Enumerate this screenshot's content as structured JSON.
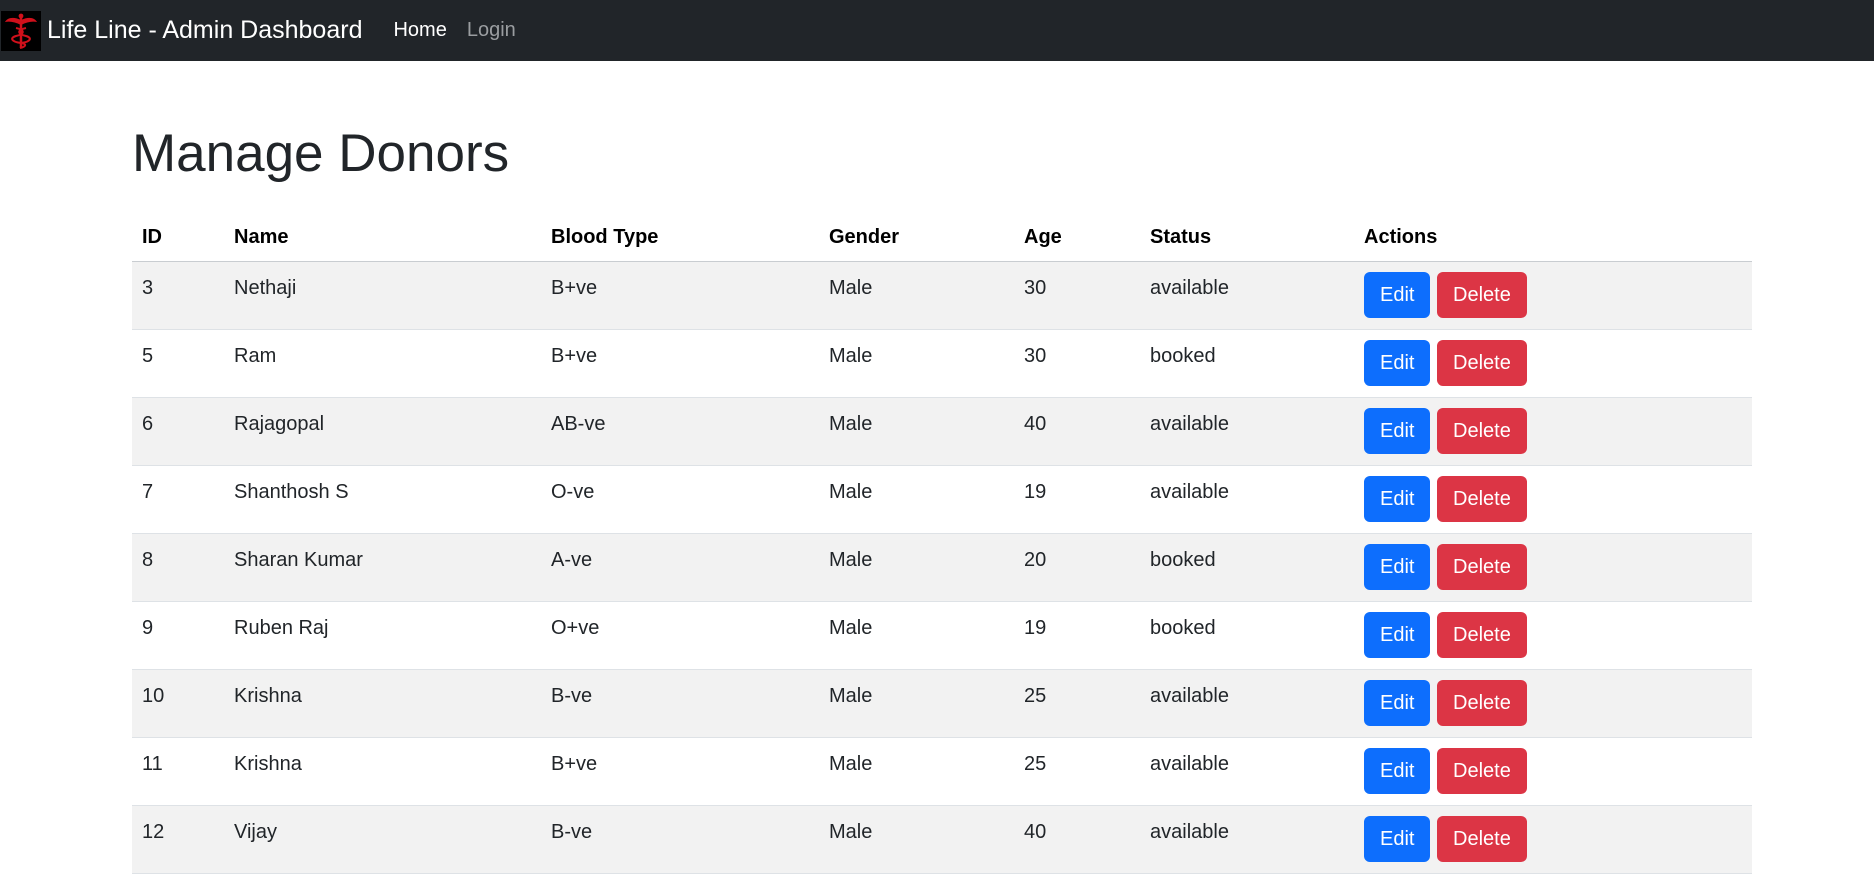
{
  "navbar": {
    "brand": "Life Line - Admin Dashboard",
    "links": [
      {
        "label": "Home",
        "active": true
      },
      {
        "label": "Login",
        "active": false
      }
    ]
  },
  "page": {
    "title": "Manage Donors"
  },
  "table": {
    "headers": [
      "ID",
      "Name",
      "Blood Type",
      "Gender",
      "Age",
      "Status",
      "Actions"
    ],
    "rows": [
      {
        "id": "3",
        "name": "Nethaji",
        "blood_type": "B+ve",
        "gender": "Male",
        "age": "30",
        "status": "available"
      },
      {
        "id": "5",
        "name": "Ram",
        "blood_type": "B+ve",
        "gender": "Male",
        "age": "30",
        "status": "booked"
      },
      {
        "id": "6",
        "name": "Rajagopal",
        "blood_type": "AB-ve",
        "gender": "Male",
        "age": "40",
        "status": "available"
      },
      {
        "id": "7",
        "name": "Shanthosh S",
        "blood_type": "O-ve",
        "gender": "Male",
        "age": "19",
        "status": "available"
      },
      {
        "id": "8",
        "name": "Sharan Kumar",
        "blood_type": "A-ve",
        "gender": "Male",
        "age": "20",
        "status": "booked"
      },
      {
        "id": "9",
        "name": "Ruben Raj",
        "blood_type": "O+ve",
        "gender": "Male",
        "age": "19",
        "status": "booked"
      },
      {
        "id": "10",
        "name": "Krishna",
        "blood_type": "B-ve",
        "gender": "Male",
        "age": "25",
        "status": "available"
      },
      {
        "id": "11",
        "name": "Krishna",
        "blood_type": "B+ve",
        "gender": "Male",
        "age": "25",
        "status": "available"
      },
      {
        "id": "12",
        "name": "Vijay",
        "blood_type": "B-ve",
        "gender": "Male",
        "age": "40",
        "status": "available"
      }
    ],
    "actions": {
      "edit_label": "Edit",
      "delete_label": "Delete"
    }
  },
  "icons": {
    "logo": "caduceus-icon"
  },
  "colors": {
    "navbar_bg": "#212529",
    "edit_button": "#0d6efd",
    "delete_button": "#dc3545",
    "logo_symbol": "#d0101b",
    "striped_row": "#f2f2f2"
  }
}
